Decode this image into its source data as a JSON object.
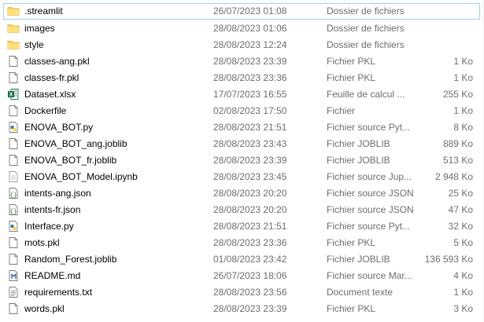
{
  "files": [
    {
      "name": ".streamlit",
      "date": "26/07/2023 01:08",
      "type": "Dossier de fichiers",
      "size": "",
      "icon": "folder-icon"
    },
    {
      "name": "images",
      "date": "28/08/2023 01:06",
      "type": "Dossier de fichiers",
      "size": "",
      "icon": "folder-icon"
    },
    {
      "name": "style",
      "date": "28/08/2023 12:24",
      "type": "Dossier de fichiers",
      "size": "",
      "icon": "folder-icon"
    },
    {
      "name": "classes-ang.pkl",
      "date": "28/08/2023 23:39",
      "type": "Fichier PKL",
      "size": "1 Ko",
      "icon": "file-icon"
    },
    {
      "name": "classes-fr.pkl",
      "date": "28/08/2023 23:36",
      "type": "Fichier PKL",
      "size": "1 Ko",
      "icon": "file-icon"
    },
    {
      "name": "Dataset.xlsx",
      "date": "17/07/2023 16:55",
      "type": "Feuille de calcul ...",
      "size": "255 Ko",
      "icon": "excel-icon"
    },
    {
      "name": "Dockerfile",
      "date": "02/08/2023 17:50",
      "type": "Fichier",
      "size": "1 Ko",
      "icon": "file-icon"
    },
    {
      "name": "ENOVA_BOT.py",
      "date": "28/08/2023 21:51",
      "type": "Fichier source Pyt...",
      "size": "8 Ko",
      "icon": "python-icon"
    },
    {
      "name": "ENOVA_BOT_ang.joblib",
      "date": "28/08/2023 23:43",
      "type": "Fichier JOBLIB",
      "size": "889 Ko",
      "icon": "file-icon"
    },
    {
      "name": "ENOVA_BOT_fr.joblib",
      "date": "28/08/2023 23:39",
      "type": "Fichier JOBLIB",
      "size": "513 Ko",
      "icon": "file-icon"
    },
    {
      "name": "ENOVA_BOT_Model.ipynb",
      "date": "28/08/2023 23:45",
      "type": "Fichier source Jup...",
      "size": "2 948 Ko",
      "icon": "notebook-icon"
    },
    {
      "name": "intents-ang.json",
      "date": "28/08/2023 20:20",
      "type": "Fichier source JSON",
      "size": "25 Ko",
      "icon": "json-icon"
    },
    {
      "name": "intents-fr.json",
      "date": "28/08/2023 20:20",
      "type": "Fichier source JSON",
      "size": "47 Ko",
      "icon": "json-icon"
    },
    {
      "name": "Interface.py",
      "date": "28/08/2023 21:51",
      "type": "Fichier source Pyt...",
      "size": "32 Ko",
      "icon": "python-icon"
    },
    {
      "name": "mots.pkl",
      "date": "28/08/2023 23:36",
      "type": "Fichier PKL",
      "size": "5 Ko",
      "icon": "file-icon"
    },
    {
      "name": "Random_Forest.joblib",
      "date": "01/08/2023 23:42",
      "type": "Fichier JOBLIB",
      "size": "136 593 Ko",
      "icon": "file-icon"
    },
    {
      "name": "README.md",
      "date": "26/07/2023 18:06",
      "type": "Fichier source Mar...",
      "size": "4 Ko",
      "icon": "markdown-icon"
    },
    {
      "name": "requirements.txt",
      "date": "28/08/2023 23:56",
      "type": "Document texte",
      "size": "1 Ko",
      "icon": "text-file-icon"
    },
    {
      "name": "words.pkl",
      "date": "28/08/2023 23:39",
      "type": "Fichier PKL",
      "size": "3 Ko",
      "icon": "file-icon"
    }
  ],
  "selected_index": 0,
  "colors": {
    "folder": "#ffd35c",
    "selection_border": "#99d1ff",
    "secondary_text": "#6d6d6d",
    "excel_green": "#1e7145",
    "python_blue": "#3776ab"
  }
}
